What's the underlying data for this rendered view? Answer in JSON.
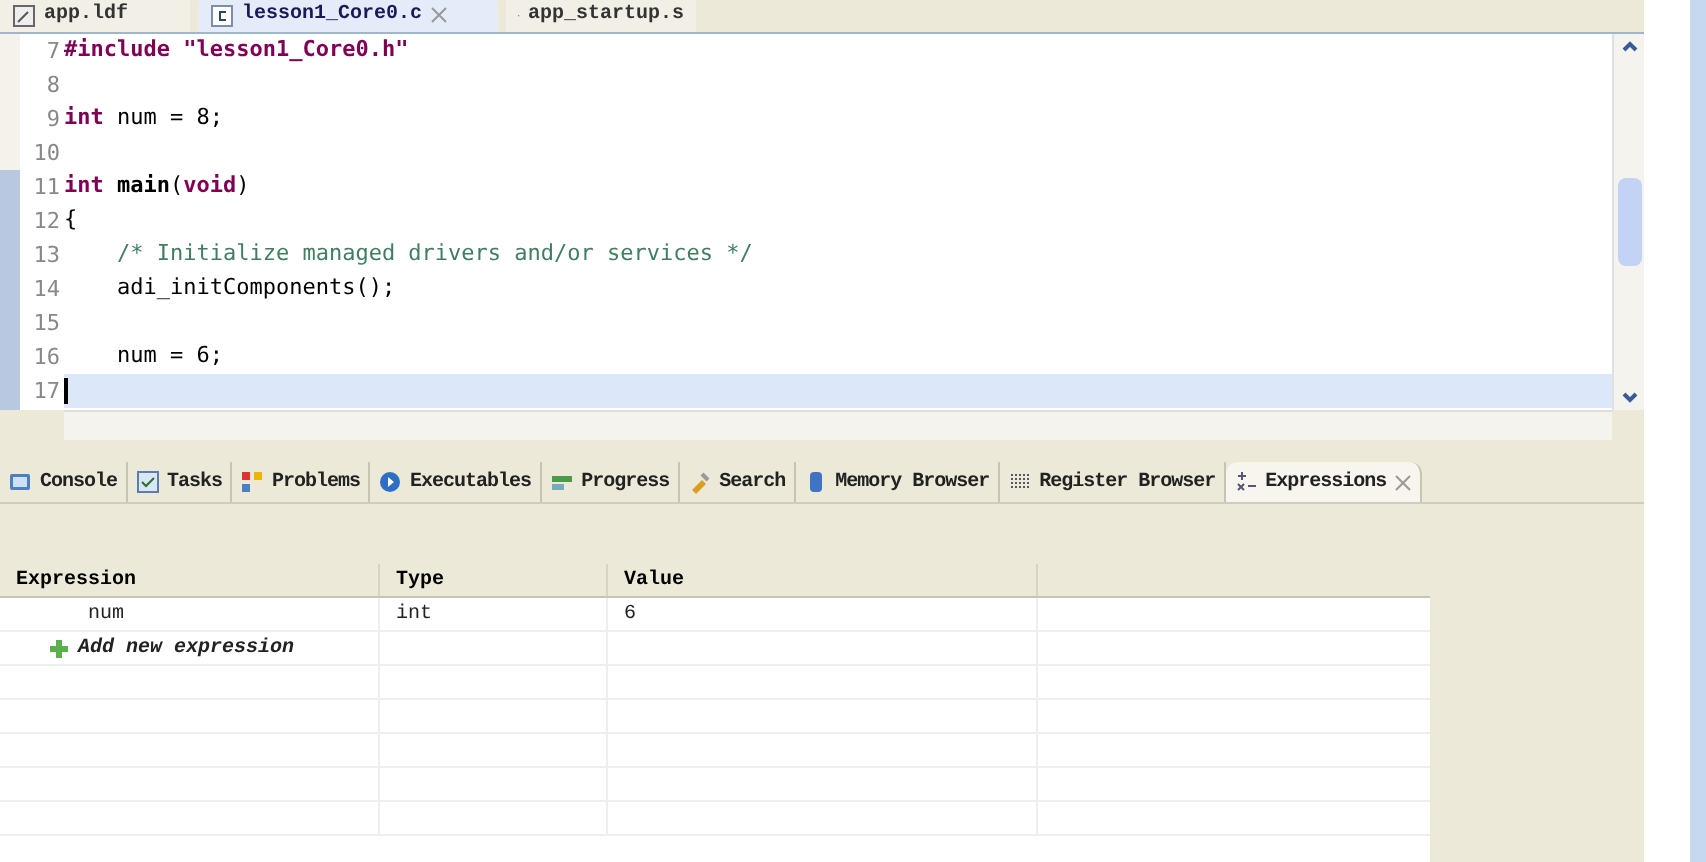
{
  "editor_tabs": [
    {
      "label": "app.ldf",
      "selected": false
    },
    {
      "label": "lesson1_Core0.c",
      "selected": true
    },
    {
      "label": "app_startup.s",
      "selected": false
    }
  ],
  "code_lines": [
    {
      "number": "7",
      "current": false,
      "tokens": [
        {
          "text": "#include \"lesson1_Core0.h\"",
          "kind": "preprocessor"
        }
      ]
    },
    {
      "number": "8",
      "current": false
    },
    {
      "number": "9",
      "current": false,
      "tokens": [
        {
          "text": "int",
          "kind": "keyword"
        },
        {
          "text": " num = 8;",
          "kind": "plain"
        }
      ]
    },
    {
      "number": "10",
      "current": false
    },
    {
      "number": "11",
      "current": false,
      "tokens": [
        {
          "text": "int",
          "kind": "keyword"
        },
        {
          "text": " main",
          "kind": "function"
        },
        {
          "text": "(",
          "kind": "plain"
        },
        {
          "text": "void",
          "kind": "keyword"
        },
        {
          "text": ")",
          "kind": "plain"
        }
      ]
    },
    {
      "number": "12",
      "current": false,
      "tokens": [
        {
          "text": "{",
          "kind": "plain"
        }
      ]
    },
    {
      "number": "13",
      "current": false,
      "tokens": [
        {
          "text": "    /* Initialize managed drivers and/or services */",
          "kind": "comment"
        }
      ]
    },
    {
      "number": "14",
      "current": false,
      "tokens": [
        {
          "text": "    adi_initComponents();",
          "kind": "plain"
        }
      ]
    },
    {
      "number": "15",
      "current": false
    },
    {
      "number": "16",
      "current": false,
      "tokens": [
        {
          "text": "    num = 6;",
          "kind": "plain"
        }
      ]
    },
    {
      "number": "17",
      "current": true
    }
  ],
  "panel_tabs": [
    {
      "label": "Console",
      "selected": false
    },
    {
      "label": "Tasks",
      "selected": false
    },
    {
      "label": "Problems",
      "selected": false
    },
    {
      "label": "Executables",
      "selected": false
    },
    {
      "label": "Progress",
      "selected": false
    },
    {
      "label": "Search",
      "selected": false
    },
    {
      "label": "Memory Browser",
      "selected": false
    },
    {
      "label": "Register Browser",
      "selected": false
    },
    {
      "label": "Expressions",
      "selected": true
    }
  ],
  "table": {
    "columns": [
      "Expression",
      "Type",
      "Value"
    ],
    "rows": [
      {
        "kind": "value",
        "cells": [
          "num",
          "int",
          "6"
        ]
      },
      {
        "kind": "add",
        "cells": [
          "Add new expression"
        ]
      }
    ]
  }
}
